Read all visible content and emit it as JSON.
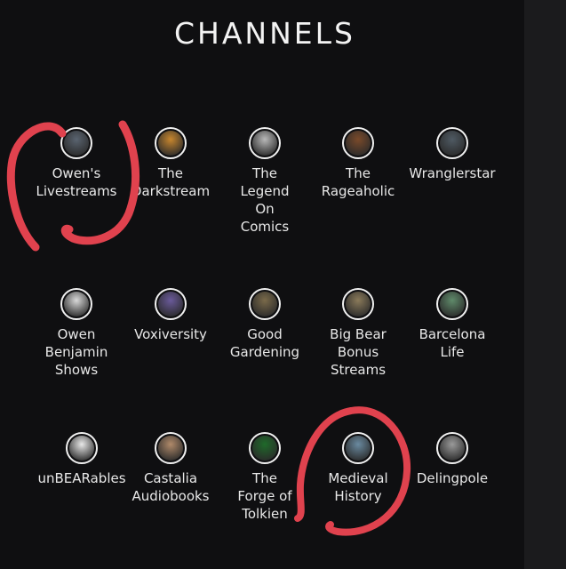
{
  "page": {
    "title": "CHANNELS"
  },
  "colors": {
    "background": "#0f0f11",
    "annotation": "#e0424e",
    "text": "#e8e8e8"
  },
  "channels": [
    {
      "label": "Owen's\nLivestreams",
      "icon": "bearded-man-avatar-icon",
      "color": "#5a6470"
    },
    {
      "label": "The\nDarkstream",
      "icon": "golden-mask-avatar-icon",
      "color": "#c7862e"
    },
    {
      "label": "The\nLegend\nOn\nComics",
      "icon": "sketch-portrait-avatar-icon",
      "color": "#b9b9b9"
    },
    {
      "label": "The\nRageaholic",
      "icon": "angry-figure-avatar-icon",
      "color": "#7a4a2a"
    },
    {
      "label": "Wranglerstar",
      "icon": "man-portrait-avatar-icon",
      "color": "#4f5a63"
    },
    {
      "label": "Owen\nBenjamin\nShows",
      "icon": "film-camera-avatar-icon",
      "color": "#d9d9d9"
    },
    {
      "label": "Voxiversity",
      "icon": "purple-book-avatar-icon",
      "color": "#6a5a9a"
    },
    {
      "label": "Good\nGardening",
      "icon": "gardener-avatar-icon",
      "color": "#7a6a4a"
    },
    {
      "label": "Big Bear\nBonus\nStreams",
      "icon": "bear-avatar-icon",
      "color": "#8a7a5a"
    },
    {
      "label": "Barcelona\nLife",
      "icon": "couple-avatar-icon",
      "color": "#5f8a6a"
    },
    {
      "label": "unBEARables",
      "icon": "bear-crest-avatar-icon",
      "color": "#e8e8e8"
    },
    {
      "label": "Castalia\nAudiobooks",
      "icon": "reader-avatar-icon",
      "color": "#b08a6a"
    },
    {
      "label": "The\nForge of\nTolkien",
      "icon": "white-tree-avatar-icon",
      "color": "#1f6a2a"
    },
    {
      "label": "Medieval\nHistory",
      "icon": "castle-avatar-icon",
      "color": "#6a8aa0"
    },
    {
      "label": "Delingpole",
      "icon": "portrait-avatar-icon",
      "color": "#9a9a9a"
    }
  ]
}
